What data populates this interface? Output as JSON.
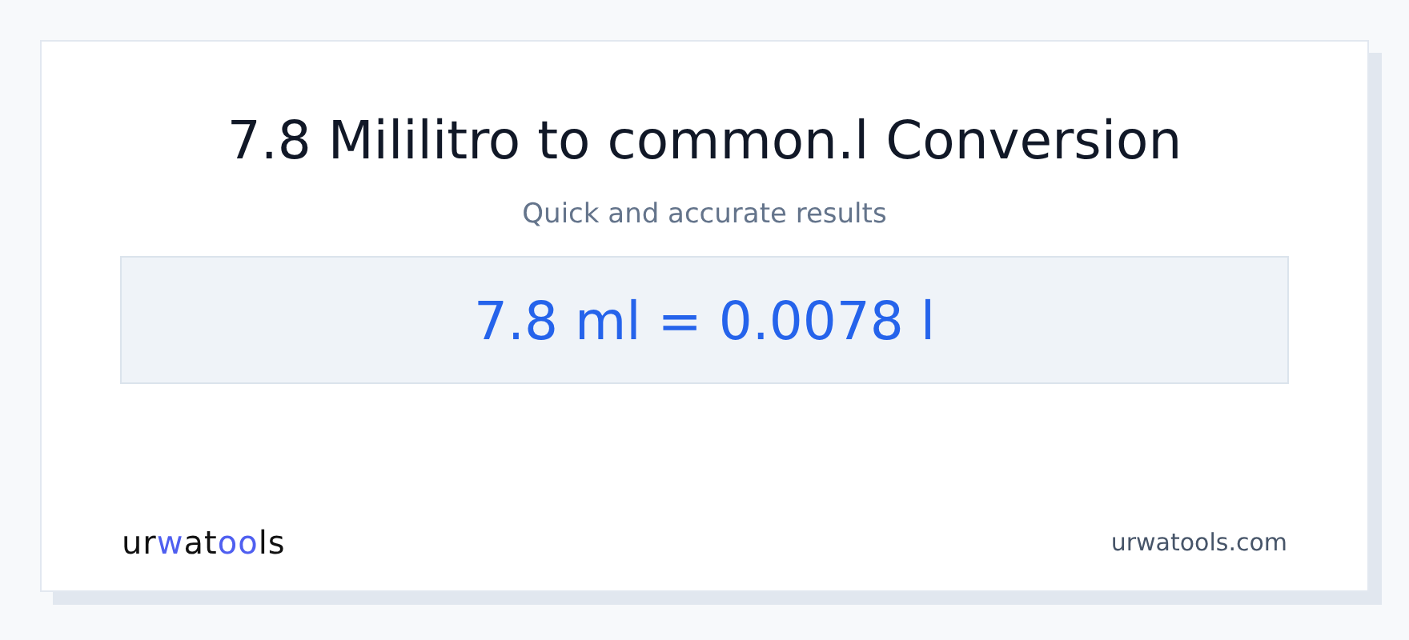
{
  "title": "7.8 Mililitro to common.l Conversion",
  "subtitle": "Quick and accurate results",
  "result": "7.8 ml = 0.0078 l",
  "logo": [
    {
      "text": "ur",
      "accent": false
    },
    {
      "text": "w",
      "accent": true
    },
    {
      "text": "at",
      "accent": false
    },
    {
      "text": "oo",
      "accent": true
    },
    {
      "text": "ls",
      "accent": false
    }
  ],
  "domain": "urwatools.com"
}
